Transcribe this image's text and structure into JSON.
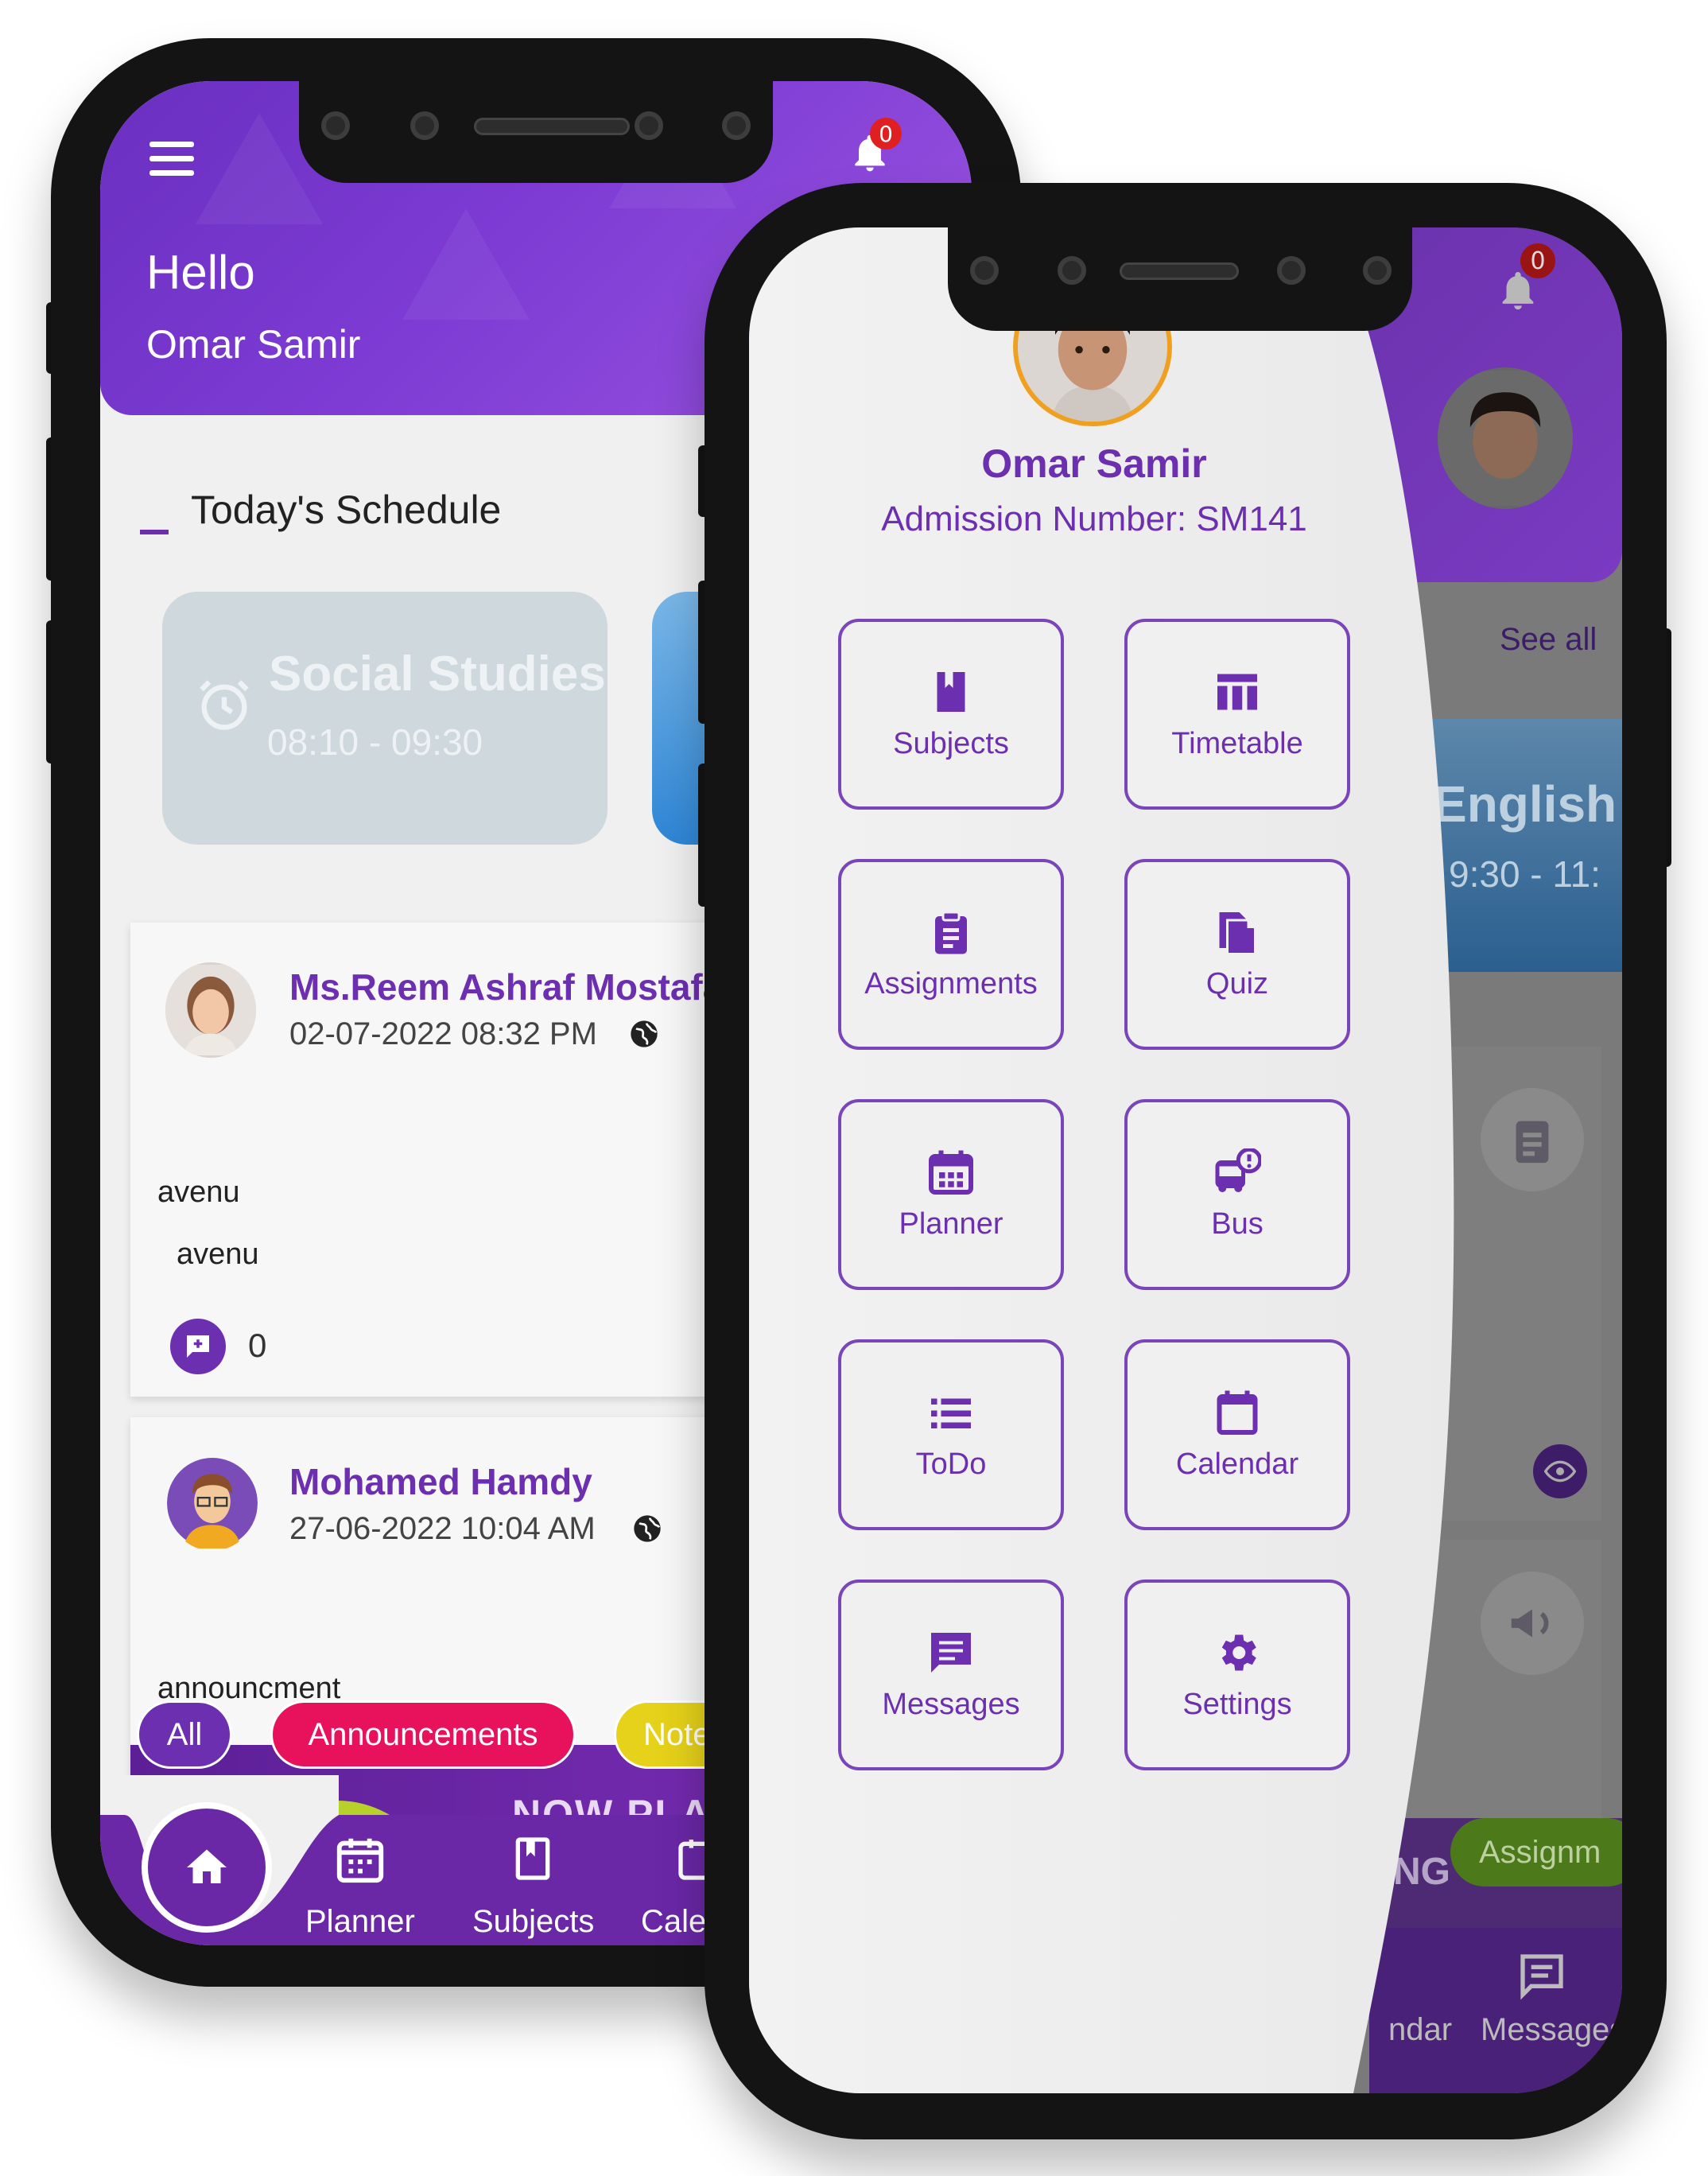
{
  "back_phone": {
    "notification_count": "0",
    "greeting": "Hello",
    "user_name": "Omar Samir",
    "section_title": "Today's Schedule",
    "schedule_card": {
      "subject": "Social Studies",
      "time": "08:10 - 09:30"
    },
    "posts": [
      {
        "author": "Ms.Reem Ashraf Mostafa",
        "date": "02-07-2022 08:32 PM",
        "title": "avenu",
        "body": "avenu",
        "comments": "0"
      },
      {
        "author": "Mohamed Hamdy",
        "date": "27-06-2022 10:04 AM",
        "title": "announcment"
      }
    ],
    "banner_text": "NOW PLAY",
    "filters": [
      "All",
      "Announcements",
      "Note"
    ],
    "nav": [
      "Planner",
      "Subjects",
      "Cale"
    ]
  },
  "front_phone": {
    "notification_count": "0",
    "profile_name": "Omar Samir",
    "admission": "Admission Number: SM141",
    "menu": [
      {
        "label": "Subjects",
        "icon": "book-icon"
      },
      {
        "label": "Timetable",
        "icon": "timetable-icon"
      },
      {
        "label": "Assignments",
        "icon": "clipboard-icon"
      },
      {
        "label": "Quiz",
        "icon": "quiz-icon"
      },
      {
        "label": "Planner",
        "icon": "calendar-grid-icon"
      },
      {
        "label": "Bus",
        "icon": "bus-icon"
      },
      {
        "label": "ToDo",
        "icon": "list-icon"
      },
      {
        "label": "Calendar",
        "icon": "calendar-icon"
      },
      {
        "label": "Messages",
        "icon": "message-icon"
      },
      {
        "label": "Settings",
        "icon": "gear-icon"
      }
    ],
    "background": {
      "see_all": "See all",
      "subject": "English",
      "time": "9:30 - 11:",
      "chip": "Assignm",
      "banner_text": "NG",
      "nav": [
        "ndar",
        "Messages"
      ]
    }
  },
  "colors": {
    "primary": "#6c2fb0",
    "header": "#7d3bd4",
    "chip_pink": "#e8125c",
    "chip_yellow": "#e6d21a",
    "chip_green": "#7fb81f"
  }
}
